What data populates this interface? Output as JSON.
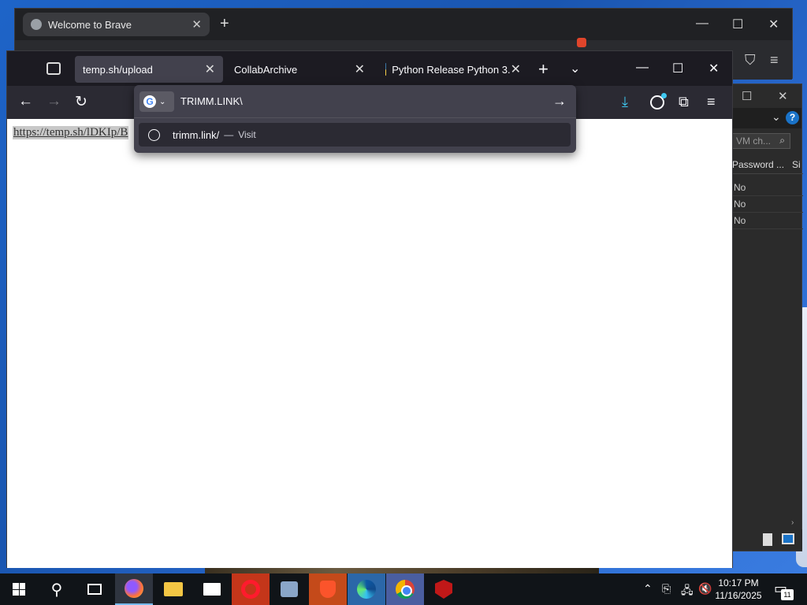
{
  "brave": {
    "tab_title": "Welcome to Brave",
    "minimize": "—",
    "maximize": "☐",
    "close": "✕",
    "new_tab": "+"
  },
  "vm": {
    "search_placeholder": "VM ch...",
    "col_password": "Password ...",
    "col_si": "Si",
    "rows": [
      "No",
      "No",
      "No"
    ],
    "help": "?"
  },
  "firefox": {
    "tabs": [
      {
        "title": "temp.sh/upload",
        "active": true
      },
      {
        "title": "CollabArchive",
        "active": false
      },
      {
        "title": "Python Release Python 3.",
        "active": false
      }
    ],
    "urlbar_value": "TRIMM.LINK\\",
    "suggestion_url": "trimm.link/",
    "suggestion_separator": "—",
    "suggestion_action": "Visit",
    "page_link_text": "https://temp.sh/lDKIp/B"
  },
  "taskbar": {
    "time": "10:17 PM",
    "date": "11/16/2025",
    "notification_count": "11"
  },
  "colors": {
    "firefox_tabbar": "#1c1b22",
    "firefox_toolbar": "#2b2a33",
    "urlbar_bg": "#42414d",
    "download_accent": "#3fc8f0"
  }
}
